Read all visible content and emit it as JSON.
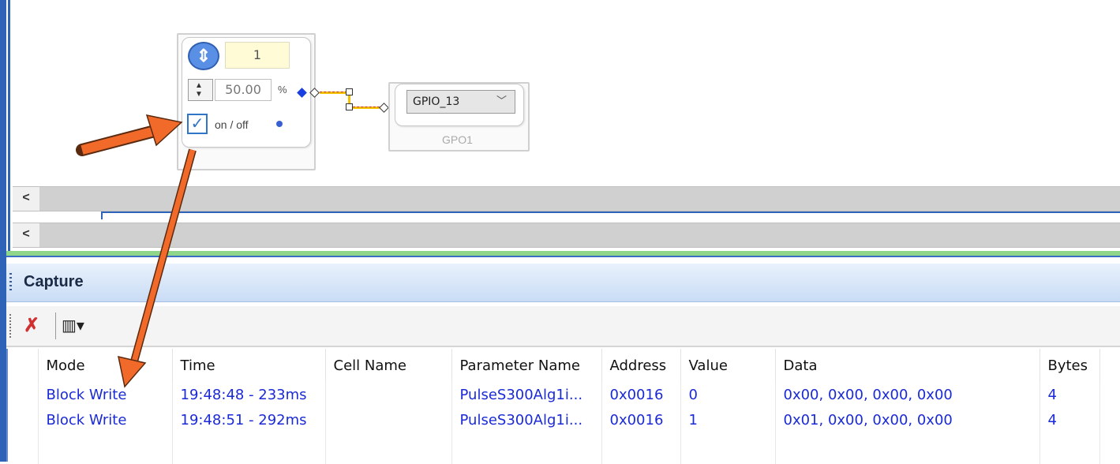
{
  "diagram": {
    "updown_glyph": "⇕",
    "counter_value": "1",
    "spinner_value": "50.00",
    "spinner_unit": "%",
    "checkbox_label": "on / off",
    "checkbox_checked": true,
    "gpio_select_value": "GPIO_13",
    "gpo_block_label": "GPO1",
    "accent_arrow_color": "#f26a2a"
  },
  "scrollbars": {
    "left_arrow": "<"
  },
  "capture": {
    "title": "Capture",
    "toolbar": {
      "clear_icon": "clear-capture-icon",
      "columns_icon": "columns-icon"
    },
    "columns": [
      "Mode",
      "Time",
      "Cell Name",
      "Parameter Name",
      "Address",
      "Value",
      "Data",
      "Bytes"
    ],
    "rows": [
      [
        "Block Write",
        "19:48:48 - 233ms",
        "",
        "PulseS300Alg1i...",
        "0x0016",
        "0",
        "0x00, 0x00, 0x00, 0x00",
        "4"
      ],
      [
        "Block Write",
        "19:48:51 - 292ms",
        "",
        "PulseS300Alg1i...",
        "0x0016",
        "1",
        "0x01, 0x00, 0x00, 0x00",
        "4"
      ]
    ]
  }
}
